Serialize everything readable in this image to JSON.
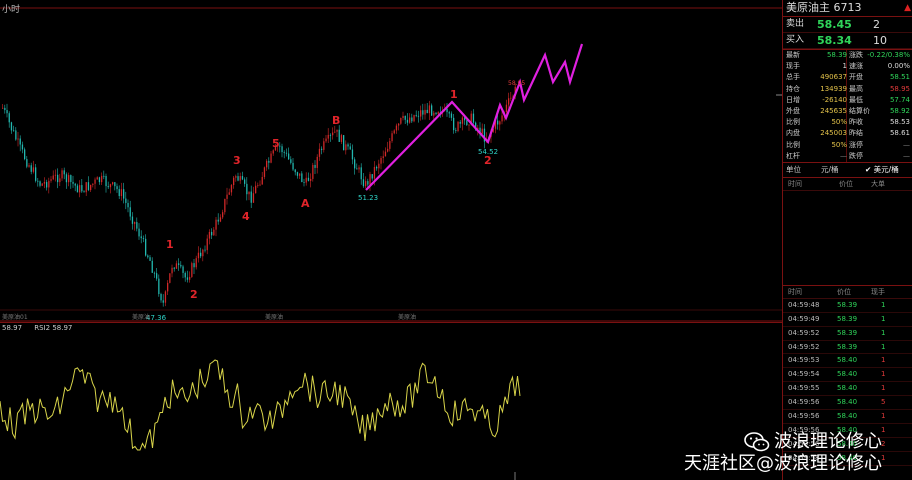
{
  "chart": {
    "period_label": "小时",
    "price_labels": {
      "low": "47.36",
      "c_low": "51.23",
      "low2": "54.52",
      "peak": "58.95"
    },
    "x_labels": [
      "美原油01",
      "美原油",
      "美原油",
      "美原油"
    ],
    "wave_labels": [
      "1",
      "2",
      "3",
      "4",
      "5",
      "A",
      "B",
      "1",
      "2"
    ],
    "colors": {
      "up_candle": "#d22828",
      "down_candle": "#22b8b0",
      "projection": "#e020e0",
      "rsi_line": "#d8d44a",
      "wave_label": "#e0242a"
    }
  },
  "rsi": {
    "header_left": "58.97",
    "header_label": "RSI2 58.97"
  },
  "quote": {
    "title": "美原油主  6713",
    "ask_label": "卖出",
    "ask_price": "58.45",
    "ask_vol": "2",
    "bid_label": "买入",
    "bid_price": "58.34",
    "bid_vol": "10",
    "stats": [
      {
        "k1": "最新",
        "v1": "58.39",
        "c1": "#2fd45a",
        "k2": "涨跌",
        "v2": "-0.22/0.38%",
        "c2": "#2fd45a"
      },
      {
        "k1": "现手",
        "v1": "1",
        "c1": "#ddd",
        "k2": "速涨",
        "v2": "0.00%",
        "c2": "#ddd"
      },
      {
        "k1": "总手",
        "v1": "490637",
        "c1": "#e3c24a",
        "k2": "开盘",
        "v2": "58.51",
        "c2": "#2fd45a"
      },
      {
        "k1": "持仓",
        "v1": "134939",
        "c1": "#e3c24a",
        "k2": "最高",
        "v2": "58.95",
        "c2": "#e03a3a"
      },
      {
        "k1": "日增",
        "v1": "-26140",
        "c1": "#e3c24a",
        "k2": "最低",
        "v2": "57.74",
        "c2": "#2fd45a"
      },
      {
        "k1": "外盘",
        "v1": "245635",
        "c1": "#e3c24a",
        "k2": "结算价",
        "v2": "58.92",
        "c2": "#2fd45a"
      },
      {
        "k1": "比例",
        "v1": "50%",
        "c1": "#e3c24a",
        "k2": "昨收",
        "v2": "58.53",
        "c2": "#ddd"
      },
      {
        "k1": "内盘",
        "v1": "245003",
        "c1": "#e3c24a",
        "k2": "昨结",
        "v2": "58.61",
        "c2": "#ddd"
      },
      {
        "k1": "比例",
        "v1": "50%",
        "c1": "#e3c24a",
        "k2": "涨停",
        "v2": "—",
        "c2": "#888"
      },
      {
        "k1": "杠杆",
        "v1": "—",
        "c1": "#888",
        "k2": "跌停",
        "v2": "—",
        "c2": "#888"
      }
    ],
    "unit_left": "单位",
    "unit_mid": "元/桶",
    "unit_right": "✔ 美元/桶",
    "trade_headers": {
      "time": "时间",
      "price": "价位",
      "vol": "大单"
    },
    "tick_headers": {
      "time": "时间",
      "price": "价位",
      "vol": "现手"
    },
    "ticks": [
      {
        "time": "04:59:48",
        "price": "58.39",
        "vol": "1",
        "vcolor": "#2fd45a"
      },
      {
        "time": "04:59:49",
        "price": "58.39",
        "vol": "1",
        "vcolor": "#2fd45a"
      },
      {
        "time": "04:59:52",
        "price": "58.39",
        "vol": "1",
        "vcolor": "#2fd45a"
      },
      {
        "time": "04:59:52",
        "price": "58.39",
        "vol": "1",
        "vcolor": "#2fd45a"
      },
      {
        "time": "04:59:53",
        "price": "58.40",
        "vol": "1",
        "vcolor": "#e03a3a"
      },
      {
        "time": "04:59:54",
        "price": "58.40",
        "vol": "1",
        "vcolor": "#e03a3a"
      },
      {
        "time": "04:59:55",
        "price": "58.40",
        "vol": "1",
        "vcolor": "#e03a3a"
      },
      {
        "time": "04:59:56",
        "price": "58.40",
        "vol": "5",
        "vcolor": "#e03a3a"
      },
      {
        "time": "04:59:56",
        "price": "58.40",
        "vol": "1",
        "vcolor": "#e03a3a"
      },
      {
        "time": "04:59:56",
        "price": "58.40",
        "vol": "1",
        "vcolor": "#e03a3a"
      },
      {
        "time": "04:59:56",
        "price": "58.40",
        "vol": "2",
        "vcolor": "#e03a3a"
      },
      {
        "time": "04:59:58",
        "price": "58.40",
        "vol": "1",
        "vcolor": "#e03a3a"
      }
    ]
  },
  "watermark": {
    "line1": "波浪理论修心",
    "line2": "天涯社区@波浪理论修心"
  }
}
